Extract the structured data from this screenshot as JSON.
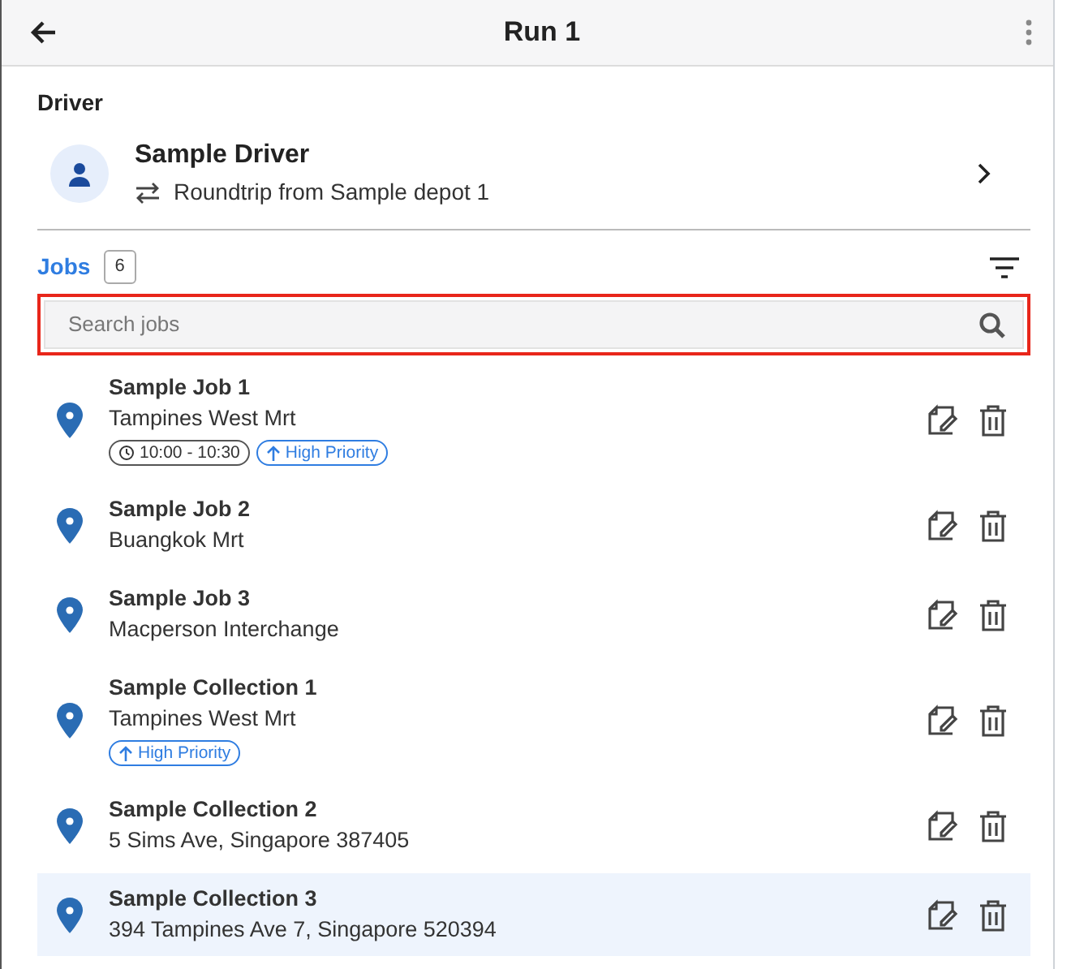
{
  "header": {
    "title": "Run 1"
  },
  "driver": {
    "section_label": "Driver",
    "name": "Sample Driver",
    "route": "Roundtrip from Sample depot 1"
  },
  "jobs": {
    "label": "Jobs",
    "count": "6"
  },
  "search": {
    "placeholder": "Search jobs",
    "highlighted": true
  },
  "job_list": [
    {
      "title": "Sample Job 1",
      "address": "Tampines West Mrt",
      "time_window": "10:00 - 10:30",
      "priority": "High Priority",
      "selected": false
    },
    {
      "title": "Sample Job 2",
      "address": "Buangkok Mrt",
      "selected": false
    },
    {
      "title": "Sample Job 3",
      "address": "Macperson Interchange",
      "selected": false
    },
    {
      "title": "Sample Collection 1",
      "address": "Tampines West Mrt",
      "priority": "High Priority",
      "selected": false
    },
    {
      "title": "Sample Collection 2",
      "address": "5 Sims Ave, Singapore 387405",
      "selected": false
    },
    {
      "title": "Sample Collection 3",
      "address": "394 Tampines Ave 7, Singapore 520394",
      "selected": true
    }
  ]
}
